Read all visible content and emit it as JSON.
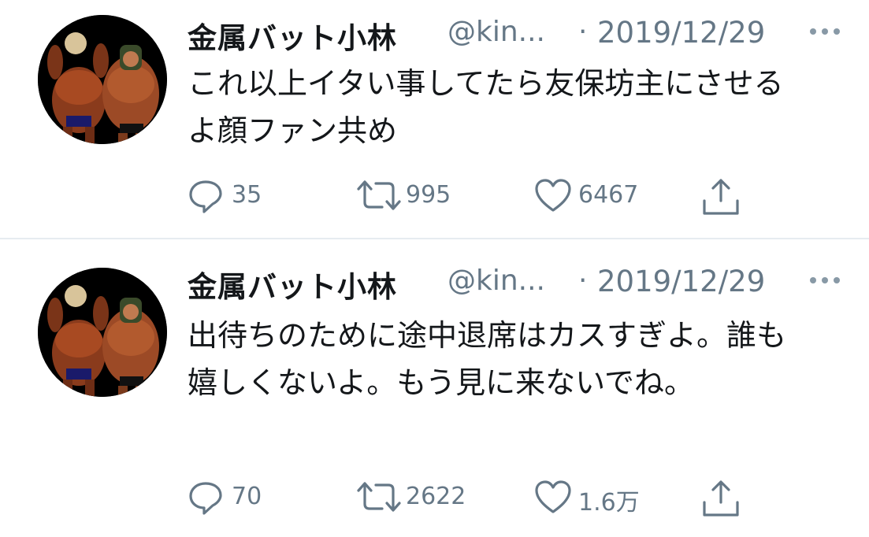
{
  "tweets": [
    {
      "display_name": "金属バット小林",
      "handle": "@kin...",
      "separator": "·",
      "date": "2019/12/29",
      "text": "これ以上イタい事してたら友保坊主にさせるよ顔ファン共め",
      "replies": "35",
      "retweets": "995",
      "likes": "6467",
      "icons": {
        "avatar": "avatar-bodybuilders",
        "more": "more-dots-icon",
        "reply": "reply-icon",
        "retweet": "retweet-icon",
        "like": "like-heart-icon",
        "share": "share-icon"
      }
    },
    {
      "display_name": "金属バット小林",
      "handle": "@kin...",
      "separator": "·",
      "date": "2019/12/29",
      "text": "出待ちのために途中退席はカスすぎよ。誰も嬉しくないよ。もう見に来ないでね。",
      "replies": "70",
      "retweets": "2622",
      "likes": "1.6万",
      "icons": {
        "avatar": "avatar-bodybuilders",
        "more": "more-dots-icon",
        "reply": "reply-icon",
        "retweet": "retweet-icon",
        "like": "like-heart-icon",
        "share": "share-icon"
      }
    }
  ],
  "colors": {
    "text_primary": "#14171a",
    "text_secondary": "#657786",
    "divider": "#e6ecf0",
    "background": "#ffffff"
  }
}
